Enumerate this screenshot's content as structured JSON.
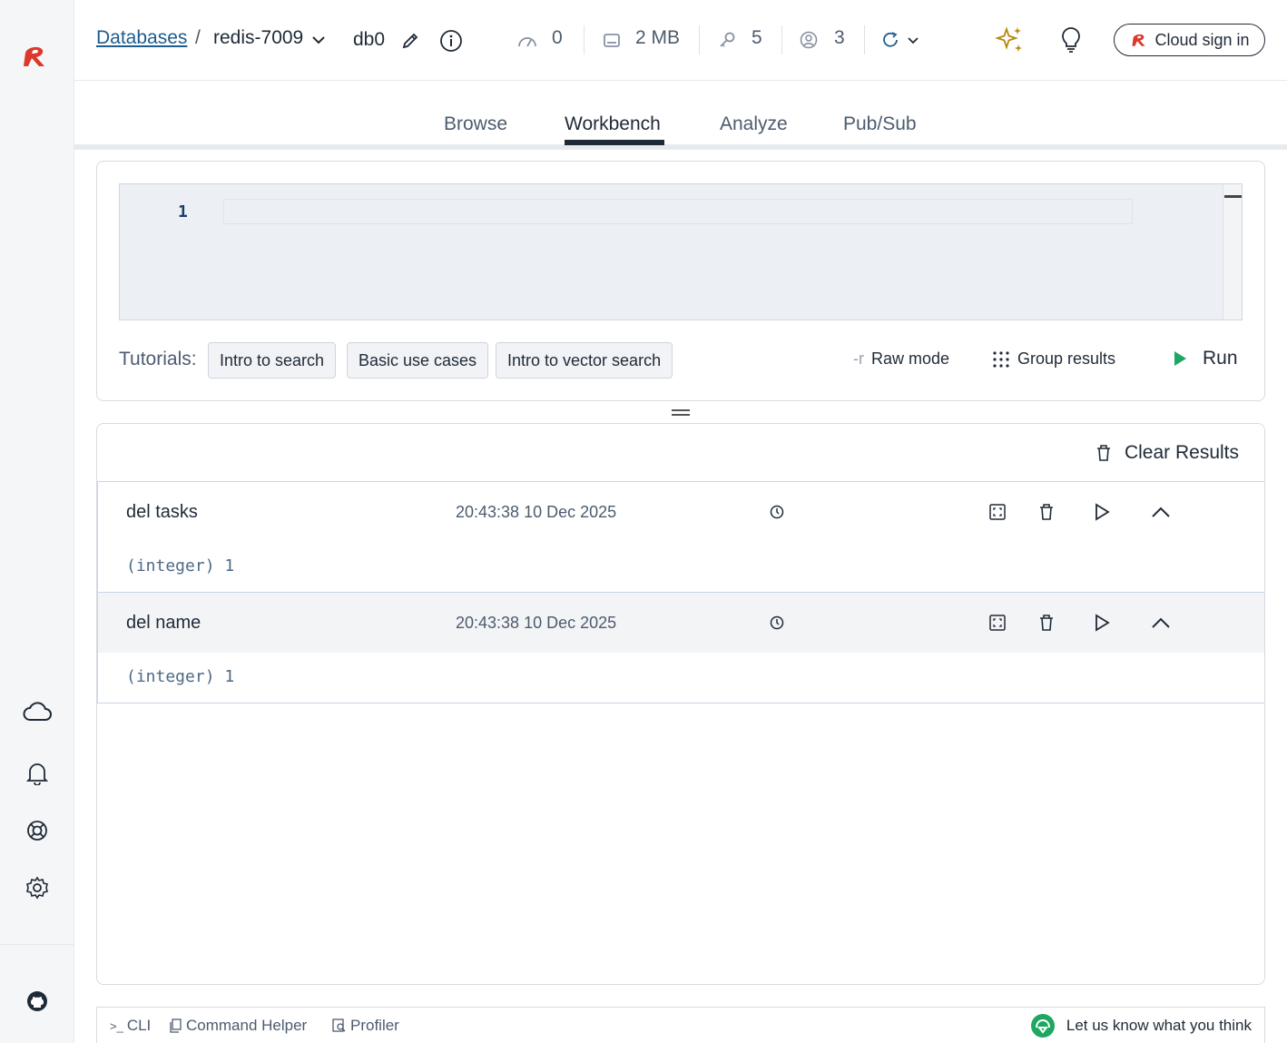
{
  "header": {
    "databases_link": "Databases",
    "separator": "/",
    "db_name": "redis-7009",
    "db_index": "db0",
    "stats": {
      "ops": "0",
      "memory": "2 MB",
      "keys": "5",
      "clients": "3"
    },
    "cloud_sign_in": "Cloud sign in"
  },
  "tabs": {
    "browse": "Browse",
    "workbench": "Workbench",
    "analyze": "Analyze",
    "pubsub": "Pub/Sub"
  },
  "editor": {
    "line_number": "1"
  },
  "tutorials": {
    "label": "Tutorials:",
    "items": [
      "Intro to search",
      "Basic use cases",
      "Intro to vector search"
    ]
  },
  "toolbar": {
    "raw_mode_prefix": "-r",
    "raw_mode": "Raw mode",
    "group_results": "Group results",
    "run": "Run"
  },
  "results": {
    "clear_label": "Clear Results",
    "items": [
      {
        "command": "del tasks",
        "time": "20:43:38 10 Dec 2025",
        "output": "(integer) 1"
      },
      {
        "command": "del name",
        "time": "20:43:38 10 Dec 2025",
        "output": "(integer) 1"
      }
    ]
  },
  "bottom_bar": {
    "cli": "CLI",
    "command_helper": "Command Helper",
    "profiler": "Profiler",
    "feedback": "Let us know what you think"
  },
  "colors": {
    "brand_red": "#dc382c",
    "run_green": "#1ea761",
    "link_blue": "#1d5c8f",
    "ai_gold": "#b8860b"
  }
}
